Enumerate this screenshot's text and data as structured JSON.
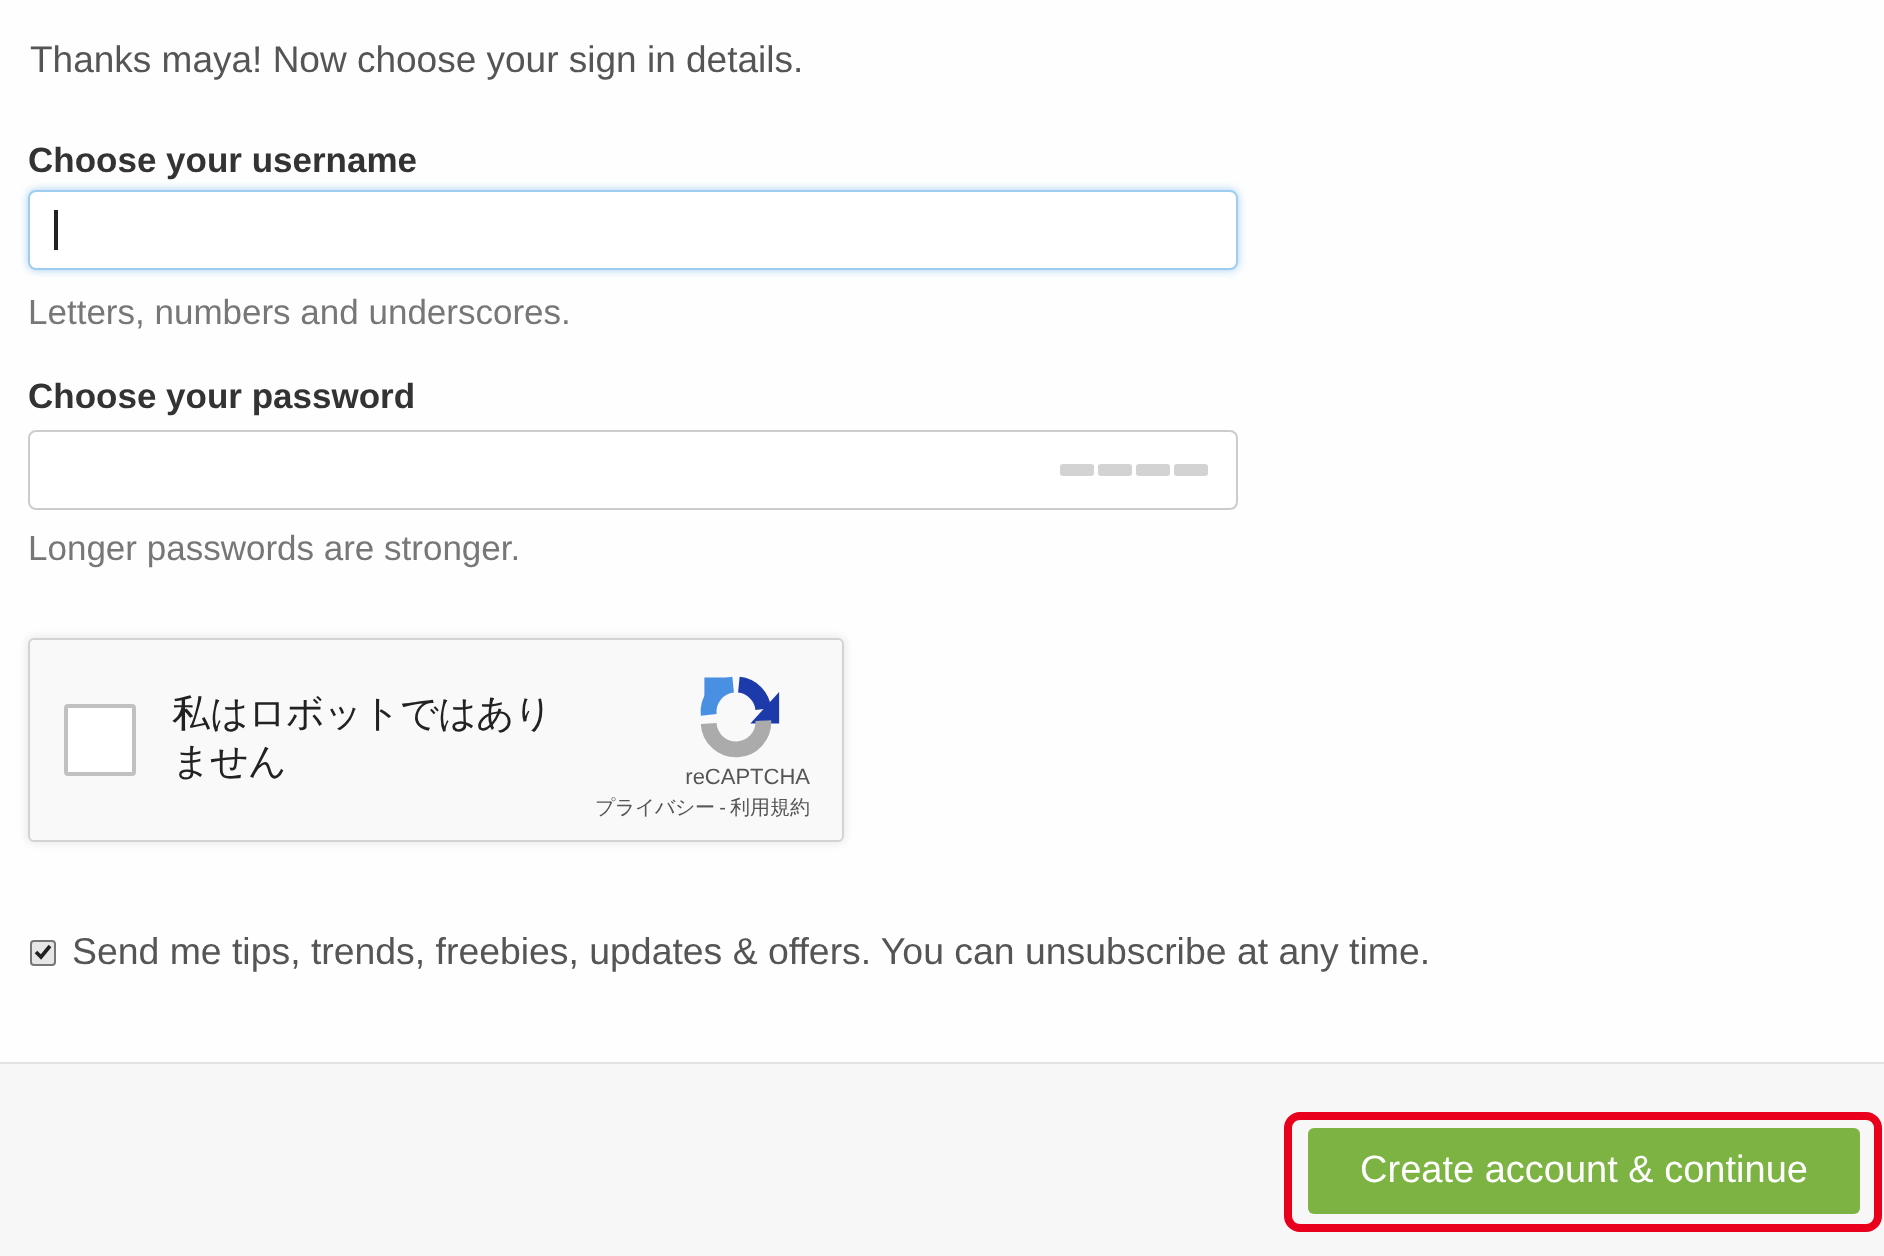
{
  "intro": "Thanks maya! Now choose your sign in details.",
  "fields": [
    {
      "kind": "text",
      "label": "Choose your username",
      "focused": true,
      "hint": "Letters, numbers and underscores."
    },
    {
      "kind": "password",
      "label": "Choose your password",
      "focused": false,
      "hint": "Longer passwords are stronger."
    }
  ],
  "captcha": {
    "label": "私はロボットではありません",
    "checked": false,
    "brand": "reCAPTCHA",
    "links": [
      "プライバシー",
      "利用規約"
    ],
    "separator": "-"
  },
  "newsletter": {
    "label": "Send me tips, trends, freebies, updates & offers. You can unsubscribe at any time.",
    "checked": true
  },
  "submit": {
    "label": "Create account & continue",
    "highlighted": true
  }
}
